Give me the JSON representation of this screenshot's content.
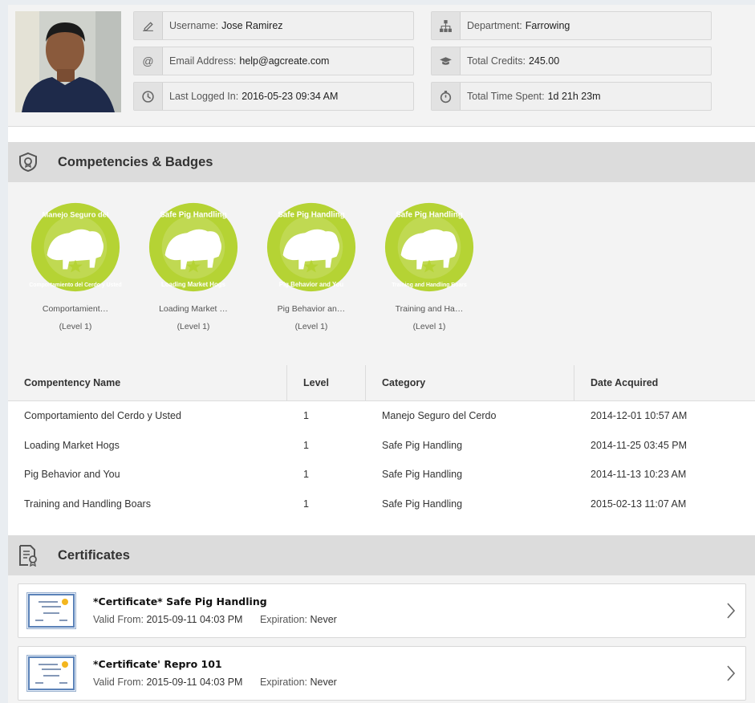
{
  "profile": {
    "avatar_alt": "profile photo",
    "username_label": "Username:",
    "username": "Jose Ramirez",
    "email_label": "Email Address:",
    "email": "help@agcreate.com",
    "last_login_label": "Last Logged In:",
    "last_login": "2016-05-23 09:34 AM",
    "department_label": "Department:",
    "department": "Farrowing",
    "credits_label": "Total Credits:",
    "credits": "245.00",
    "time_label": "Total Time Spent:",
    "time_spent": "1d 21h 23m"
  },
  "competencies": {
    "title": "Competencies & Badges",
    "badges": [
      {
        "name": "Comportamient…",
        "level": "(Level 1)",
        "top_text": "Manejo Seguro del",
        "bottom_text": "Comportamiento del Cerdo y Usted"
      },
      {
        "name": "Loading Market …",
        "level": "(Level 1)",
        "top_text": "Safe Pig Handling",
        "bottom_text": "Loading Market Hogs"
      },
      {
        "name": "Pig Behavior an…",
        "level": "(Level 1)",
        "top_text": "Safe Pig Handling",
        "bottom_text": "Pig Behavior and You"
      },
      {
        "name": "Training and Ha…",
        "level": "(Level 1)",
        "top_text": "Safe Pig Handling",
        "bottom_text": "Training and Handling Boars"
      }
    ],
    "badge_color": "#b5d334",
    "table": {
      "headers": [
        "Compentency Name",
        "Level",
        "Category",
        "Date Acquired"
      ],
      "rows": [
        [
          "Comportamiento del Cerdo y Usted",
          "1",
          "Manejo Seguro del Cerdo",
          "2014-12-01 10:57 AM"
        ],
        [
          "Loading Market Hogs",
          "1",
          "Safe Pig Handling",
          "2014-11-25 03:45 PM"
        ],
        [
          "Pig Behavior and You",
          "1",
          "Safe Pig Handling",
          "2014-11-13 10:23 AM"
        ],
        [
          "Training and Handling Boars",
          "1",
          "Safe Pig Handling",
          "2015-02-13 11:07 AM"
        ]
      ]
    }
  },
  "certificates": {
    "title": "Certificates",
    "valid_label": "Valid From:",
    "expiration_label": "Expiration:",
    "items": [
      {
        "title": "*Certificate* Safe Pig Handling",
        "valid_from": "2015-09-11 04:03 PM",
        "expiration": "Never"
      },
      {
        "title": "*Certificate' Repro 101",
        "valid_from": "2015-09-11 04:03 PM",
        "expiration": "Never"
      }
    ]
  }
}
